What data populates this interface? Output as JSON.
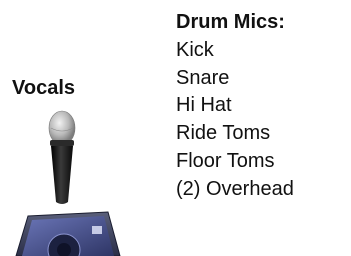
{
  "vocals": {
    "label": "Vocals",
    "icons": [
      "microphone-icon",
      "stage-monitor-icon"
    ]
  },
  "drum_mics": {
    "title": "Drum Mics:",
    "items": [
      "Kick",
      "Snare",
      "Hi Hat",
      "Ride Toms",
      "Floor Toms",
      "(2) Overhead"
    ]
  },
  "colors": {
    "text": "#111111",
    "mic_body": "#1a1a1a",
    "mic_grille": "#c9c9c9",
    "monitor_body": "#1e2340",
    "monitor_face": "#4a5490"
  }
}
